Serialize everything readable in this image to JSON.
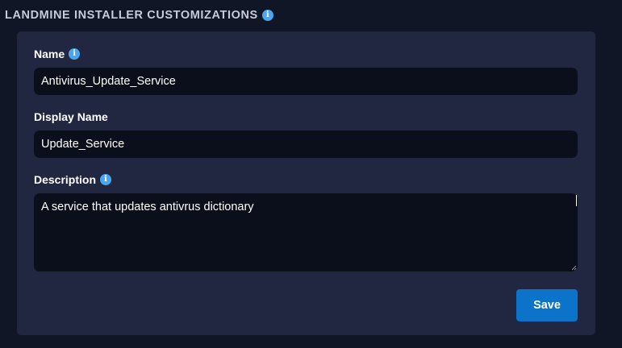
{
  "section": {
    "title": "LANDMINE INSTALLER CUSTOMIZATIONS",
    "info_icon": "i"
  },
  "form": {
    "name": {
      "label": "Name",
      "info_icon": "i",
      "value": "Antivirus_Update_Service"
    },
    "display_name": {
      "label": "Display Name",
      "value": "Update_Service"
    },
    "description": {
      "label": "Description",
      "info_icon": "i",
      "value": "A service that updates antivrus dictionary"
    },
    "save_label": "Save"
  },
  "colors": {
    "page_background": "#111627",
    "card_background": "#212741",
    "input_background": "#0b0f1b",
    "info_icon": "#4aa6ee",
    "save_button": "#0b73c9"
  }
}
